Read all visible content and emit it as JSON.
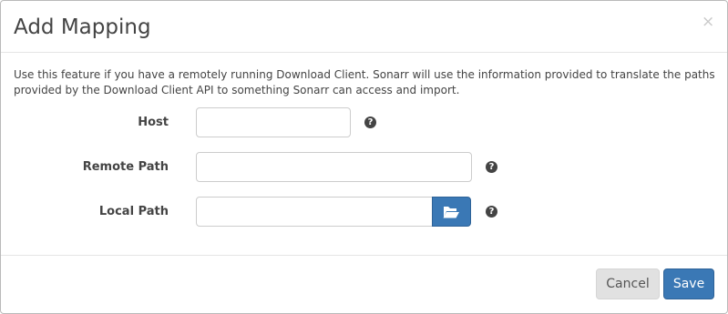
{
  "modal": {
    "title": "Add Mapping",
    "close_symbol": "×",
    "description": "Use this feature if you have a remotely running Download Client. Sonarr will use the information provided to translate the paths provided by the Download Client API to something Sonarr can access and import."
  },
  "form": {
    "host": {
      "label": "Host",
      "value": "",
      "help_symbol": "?"
    },
    "remote_path": {
      "label": "Remote Path",
      "value": "",
      "help_symbol": "?"
    },
    "local_path": {
      "label": "Local Path",
      "value": "",
      "help_symbol": "?",
      "browse_icon": "folder-open-icon"
    }
  },
  "footer": {
    "cancel_label": "Cancel",
    "save_label": "Save"
  },
  "colors": {
    "primary": "#3a78b5",
    "cancel_bg": "#e1e1e1",
    "text": "#444444"
  }
}
